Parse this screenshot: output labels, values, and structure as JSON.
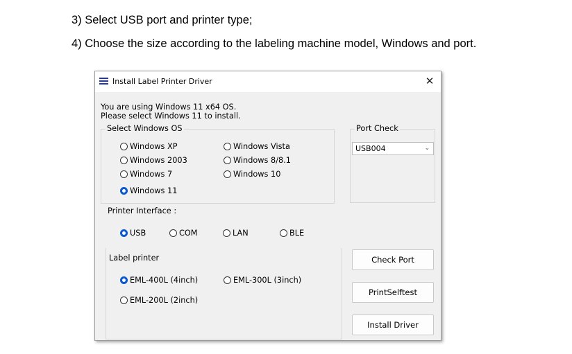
{
  "doc": {
    "line1": "3) Select USB port and printer type;",
    "line2": "4) Choose the size according to the labeling machine model, Windows and port."
  },
  "window": {
    "title": "Install Label Printer Driver",
    "close_glyph": "✕",
    "icon": "app-icon"
  },
  "info": {
    "line1": "You are using Windows 11 x64 OS.",
    "line2": "Please select Windows 11 to install."
  },
  "os_group": {
    "legend": "Select Windows OS",
    "options": [
      "Windows XP",
      "Windows 2003",
      "Windows 7",
      "Windows 11",
      "Windows Vista",
      "Windows 8/8.1",
      "Windows 10"
    ],
    "selected": "Windows 11"
  },
  "port_group": {
    "legend": "Port Check",
    "selected_value": "USB004"
  },
  "interface": {
    "label": "Printer Interface :",
    "options": [
      "USB",
      "COM",
      "LAN",
      "BLE"
    ],
    "selected": "USB"
  },
  "label_printer": {
    "legend": "Label printer",
    "options": [
      "EML-400L (4inch)",
      "EML-300L (3inch)",
      "EML-200L (2inch)"
    ],
    "selected": "EML-400L (4inch)"
  },
  "buttons": {
    "check_port": "Check Port",
    "selftest": "PrintSelftest",
    "install": "Install Driver"
  }
}
